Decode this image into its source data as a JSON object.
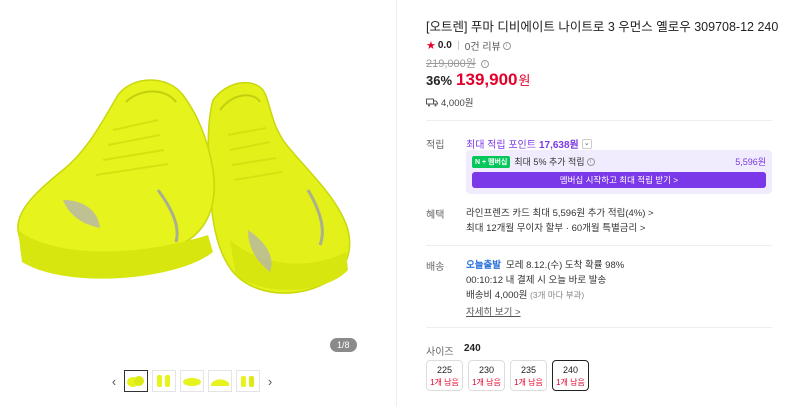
{
  "gallery": {
    "counter": "1/8",
    "thumb_count": 5,
    "prev_icon": "chevron-left-icon",
    "next_icon": "chevron-right-icon",
    "shoe_color": "#e9f51a"
  },
  "product": {
    "title": "[오트렌] 푸마 디비에이트 나이트로 3 우먼스 옐로우 309708-12 240",
    "rating": "0.0",
    "review_text": "0건 리뷰",
    "original_price": "219,000원",
    "discount": "36%",
    "sale_price": "139,900",
    "sale_unit": "원",
    "shipping_fee": "4,000원"
  },
  "points": {
    "label": "적립",
    "max_text": "최대 적립 포인트",
    "max_value": "17,638원",
    "member_badge_n": "N",
    "member_badge_text": "멤버십",
    "member_text": "최대 5% 추가 적립",
    "member_value": "5,596원",
    "member_button": "멤버십 시작하고 최대 적립 받기 >"
  },
  "benefits": {
    "label": "혜택",
    "line1": "라인프렌즈 카드 최대 5,596원 추가 적립(4%) >",
    "line2": "최대 12개월 무이자 할부 · 60개월 특별금리 >"
  },
  "delivery": {
    "label": "배송",
    "badge": "오늘출발",
    "line1": "모레 8.12.(수) 도착 확률 98%",
    "line2": "00:10:12  내 결제 시 오늘 바로 발송",
    "line3": "배송비 4,000원",
    "line3_note": "(3개 마다 부과)",
    "more_link": "자세히 보기 >"
  },
  "size": {
    "label": "사이즈",
    "selected": "240",
    "options": [
      {
        "size": "225",
        "stock": "1개 남음"
      },
      {
        "size": "230",
        "stock": "1개 남음"
      },
      {
        "size": "235",
        "stock": "1개 남음"
      },
      {
        "size": "240",
        "stock": "1개 남음"
      }
    ]
  },
  "colors": {
    "accent": "#e4002b",
    "purple": "#7b38e9",
    "blue": "#2a6fdb"
  }
}
